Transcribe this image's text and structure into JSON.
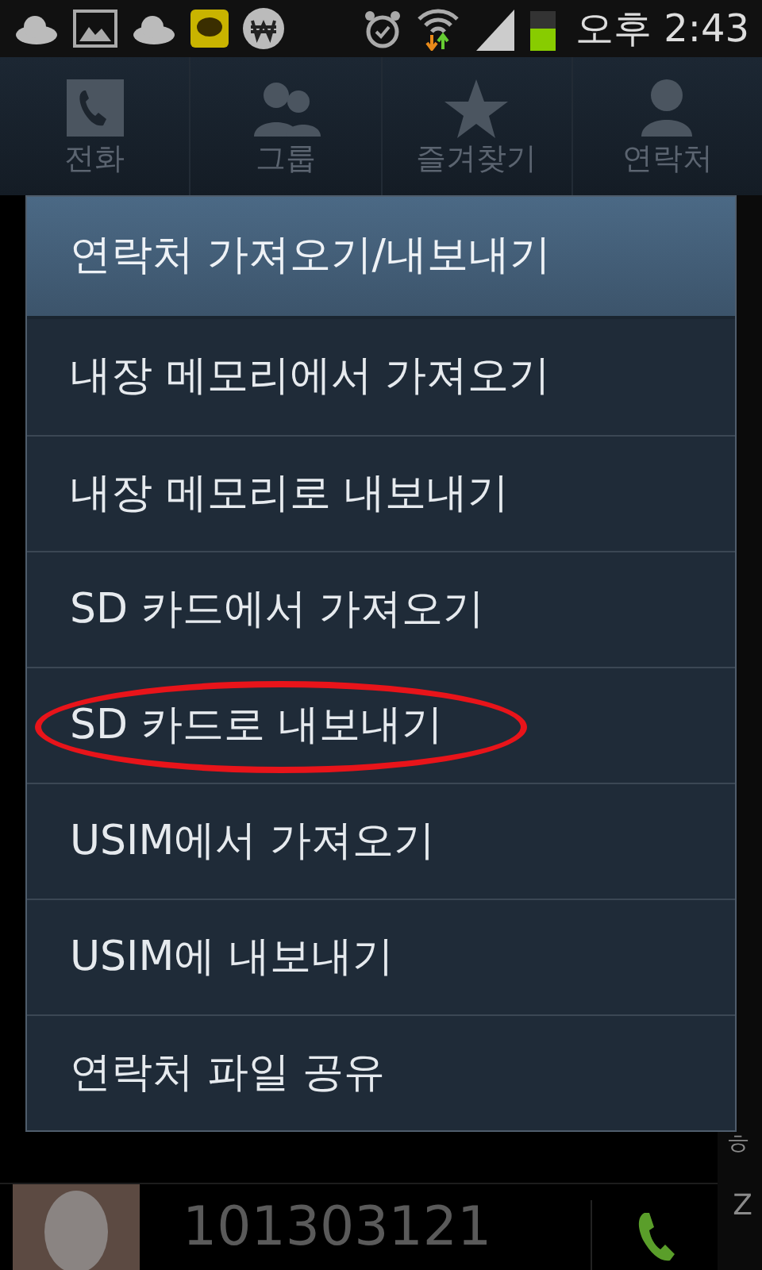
{
  "status_bar": {
    "time": "오후 2:43"
  },
  "tabs": [
    {
      "label": "전화",
      "kind": "phone"
    },
    {
      "label": "그룹",
      "kind": "group"
    },
    {
      "label": "즐겨찾기",
      "kind": "star"
    },
    {
      "label": "연락처",
      "kind": "person"
    }
  ],
  "index_letters": [
    "ㅎ",
    "Z"
  ],
  "contact_row": {
    "number": "101303121"
  },
  "menu": {
    "title": "연락처 가져오기/내보내기",
    "items": [
      {
        "label": "내장 메모리에서 가져오기",
        "circled": false
      },
      {
        "label": "내장 메모리로 내보내기",
        "circled": false
      },
      {
        "label": "SD 카드에서 가져오기",
        "circled": false
      },
      {
        "label": "SD 카드로 내보내기",
        "circled": true
      },
      {
        "label": "USIM에서 가져오기",
        "circled": false
      },
      {
        "label": "USIM에 내보내기",
        "circled": false
      },
      {
        "label": "연락처 파일 공유",
        "circled": false
      }
    ]
  }
}
